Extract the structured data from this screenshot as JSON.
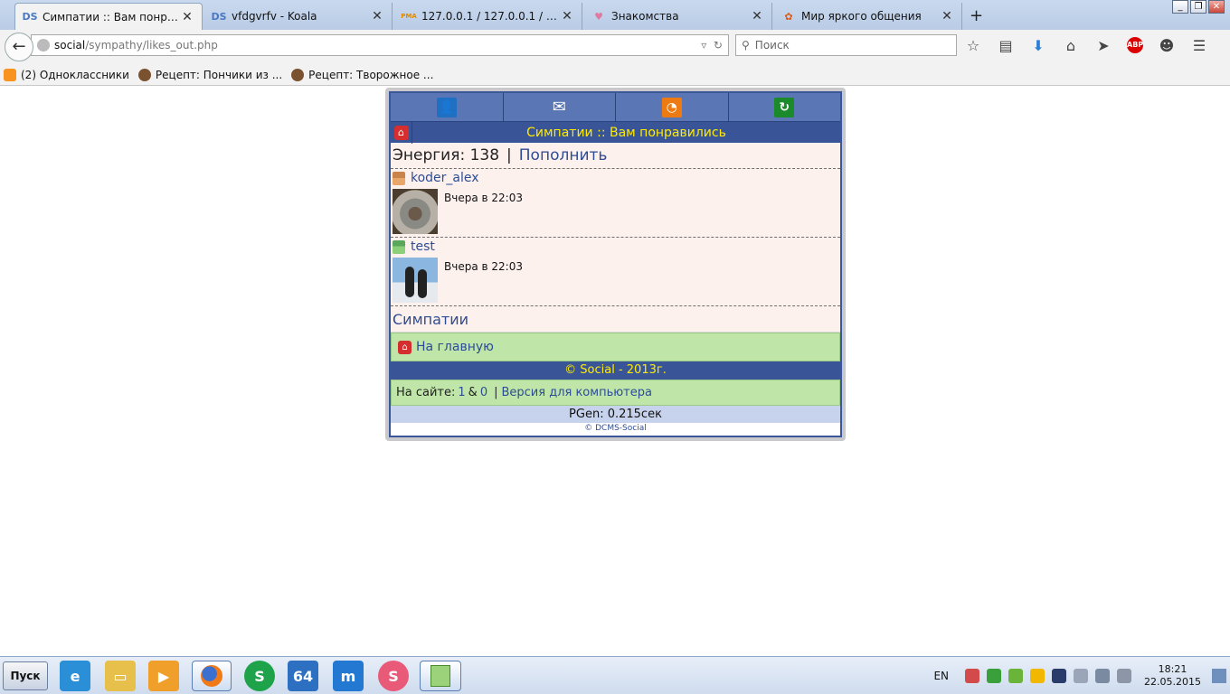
{
  "browser": {
    "tabs": [
      {
        "title": "Симпатии :: Вам понравились",
        "icon": "DS"
      },
      {
        "title": "vfdgvrfv - Koala",
        "icon": "DS"
      },
      {
        "title": "127.0.0.1 / 127.0.0.1 / social...",
        "icon": "PMA"
      },
      {
        "title": "Знакомства",
        "icon": "♥"
      },
      {
        "title": "Мир яркого общения",
        "icon": "✿"
      }
    ],
    "url_host": "social",
    "url_path": "/sympathy/likes_out.php",
    "search_placeholder": "Поиск",
    "bookmarks": [
      "(2) Одноклассники",
      "Рецепт: Пончики из ...",
      "Рецепт: Творожное ..."
    ]
  },
  "page": {
    "title": "Симпатии :: Вам понравились",
    "energy_label": "Энергия: 138",
    "energy_sep": "|",
    "energy_link": "Пополнить",
    "users": [
      {
        "name": "koder_alex",
        "time": "Вчера в 22:03"
      },
      {
        "name": "test",
        "time": "Вчера в 22:03"
      }
    ],
    "sympathy_link": "Симпатии",
    "home_link": "На главную",
    "copyright": "© Social - 2013г.",
    "online_label": "На сайте:",
    "online_users": "1",
    "online_amp": "&",
    "online_guests": "0",
    "online_sep": "|",
    "desktop_link": "Версия для компьютера",
    "pgen": "PGen: 0.215сек",
    "engine": "© DCMS-Social"
  },
  "taskbar": {
    "start_label": "Пуск",
    "lang": "EN",
    "time": "18:21",
    "date": "22.05.2015"
  },
  "colors": {
    "header_blue": "#3a5597",
    "title_yellow": "#ffeb00",
    "row_bg": "#fdf1ee",
    "green_row": "#bfe6a8"
  }
}
